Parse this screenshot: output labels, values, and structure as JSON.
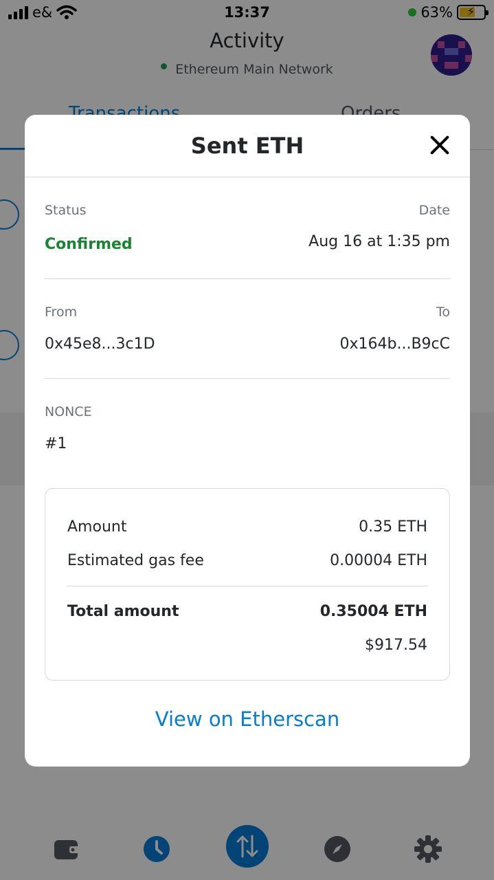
{
  "status_bar": {
    "carrier": "e&",
    "time": "13:37",
    "battery": "63%"
  },
  "header": {
    "title": "Activity",
    "network": "Ethereum Main Network"
  },
  "tabs": [
    "Transactions",
    "Orders"
  ],
  "modal": {
    "title": "Sent ETH",
    "status_label": "Status",
    "status_value": "Confirmed",
    "date_label": "Date",
    "date_value": "Aug 16 at 1:35 pm",
    "from_label": "From",
    "from_value": "0x45e8...3c1D",
    "to_label": "To",
    "to_value": "0x164b...B9cC",
    "nonce_label": "NONCE",
    "nonce_value": "#1",
    "summary": {
      "amount_label": "Amount",
      "amount_value": "0.35 ETH",
      "gas_label": "Estimated gas fee",
      "gas_value": "0.00004 ETH",
      "total_label": "Total amount",
      "total_value": "0.35004 ETH",
      "total_fiat": "$917.54"
    },
    "etherscan_link": "View on Etherscan"
  },
  "nav": [
    "wallet-icon",
    "clock-icon",
    "swap-icon",
    "compass-icon",
    "gear-icon"
  ],
  "colors": {
    "accent": "#037dd6",
    "confirmed": "#1c8234",
    "network_dot": "#1f9f5e"
  }
}
